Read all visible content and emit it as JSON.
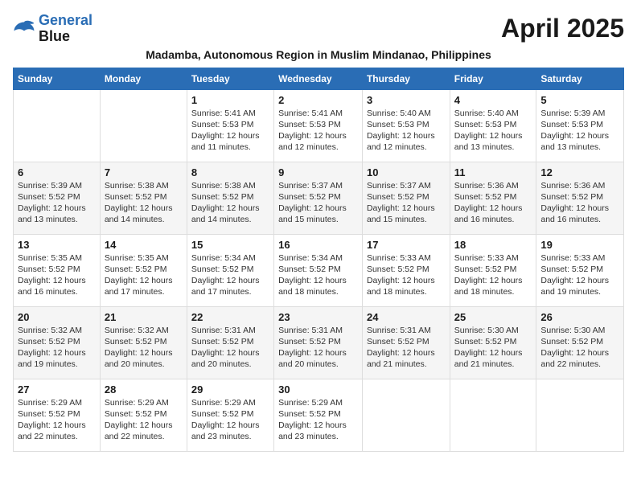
{
  "logo": {
    "line1": "General",
    "line2": "Blue"
  },
  "title": "April 2025",
  "subtitle": "Madamba, Autonomous Region in Muslim Mindanao, Philippines",
  "weekdays": [
    "Sunday",
    "Monday",
    "Tuesday",
    "Wednesday",
    "Thursday",
    "Friday",
    "Saturday"
  ],
  "weeks": [
    [
      {
        "day": "",
        "info": ""
      },
      {
        "day": "",
        "info": ""
      },
      {
        "day": "1",
        "info": "Sunrise: 5:41 AM\nSunset: 5:53 PM\nDaylight: 12 hours and 11 minutes."
      },
      {
        "day": "2",
        "info": "Sunrise: 5:41 AM\nSunset: 5:53 PM\nDaylight: 12 hours and 12 minutes."
      },
      {
        "day": "3",
        "info": "Sunrise: 5:40 AM\nSunset: 5:53 PM\nDaylight: 12 hours and 12 minutes."
      },
      {
        "day": "4",
        "info": "Sunrise: 5:40 AM\nSunset: 5:53 PM\nDaylight: 12 hours and 13 minutes."
      },
      {
        "day": "5",
        "info": "Sunrise: 5:39 AM\nSunset: 5:53 PM\nDaylight: 12 hours and 13 minutes."
      }
    ],
    [
      {
        "day": "6",
        "info": "Sunrise: 5:39 AM\nSunset: 5:52 PM\nDaylight: 12 hours and 13 minutes."
      },
      {
        "day": "7",
        "info": "Sunrise: 5:38 AM\nSunset: 5:52 PM\nDaylight: 12 hours and 14 minutes."
      },
      {
        "day": "8",
        "info": "Sunrise: 5:38 AM\nSunset: 5:52 PM\nDaylight: 12 hours and 14 minutes."
      },
      {
        "day": "9",
        "info": "Sunrise: 5:37 AM\nSunset: 5:52 PM\nDaylight: 12 hours and 15 minutes."
      },
      {
        "day": "10",
        "info": "Sunrise: 5:37 AM\nSunset: 5:52 PM\nDaylight: 12 hours and 15 minutes."
      },
      {
        "day": "11",
        "info": "Sunrise: 5:36 AM\nSunset: 5:52 PM\nDaylight: 12 hours and 16 minutes."
      },
      {
        "day": "12",
        "info": "Sunrise: 5:36 AM\nSunset: 5:52 PM\nDaylight: 12 hours and 16 minutes."
      }
    ],
    [
      {
        "day": "13",
        "info": "Sunrise: 5:35 AM\nSunset: 5:52 PM\nDaylight: 12 hours and 16 minutes."
      },
      {
        "day": "14",
        "info": "Sunrise: 5:35 AM\nSunset: 5:52 PM\nDaylight: 12 hours and 17 minutes."
      },
      {
        "day": "15",
        "info": "Sunrise: 5:34 AM\nSunset: 5:52 PM\nDaylight: 12 hours and 17 minutes."
      },
      {
        "day": "16",
        "info": "Sunrise: 5:34 AM\nSunset: 5:52 PM\nDaylight: 12 hours and 18 minutes."
      },
      {
        "day": "17",
        "info": "Sunrise: 5:33 AM\nSunset: 5:52 PM\nDaylight: 12 hours and 18 minutes."
      },
      {
        "day": "18",
        "info": "Sunrise: 5:33 AM\nSunset: 5:52 PM\nDaylight: 12 hours and 18 minutes."
      },
      {
        "day": "19",
        "info": "Sunrise: 5:33 AM\nSunset: 5:52 PM\nDaylight: 12 hours and 19 minutes."
      }
    ],
    [
      {
        "day": "20",
        "info": "Sunrise: 5:32 AM\nSunset: 5:52 PM\nDaylight: 12 hours and 19 minutes."
      },
      {
        "day": "21",
        "info": "Sunrise: 5:32 AM\nSunset: 5:52 PM\nDaylight: 12 hours and 20 minutes."
      },
      {
        "day": "22",
        "info": "Sunrise: 5:31 AM\nSunset: 5:52 PM\nDaylight: 12 hours and 20 minutes."
      },
      {
        "day": "23",
        "info": "Sunrise: 5:31 AM\nSunset: 5:52 PM\nDaylight: 12 hours and 20 minutes."
      },
      {
        "day": "24",
        "info": "Sunrise: 5:31 AM\nSunset: 5:52 PM\nDaylight: 12 hours and 21 minutes."
      },
      {
        "day": "25",
        "info": "Sunrise: 5:30 AM\nSunset: 5:52 PM\nDaylight: 12 hours and 21 minutes."
      },
      {
        "day": "26",
        "info": "Sunrise: 5:30 AM\nSunset: 5:52 PM\nDaylight: 12 hours and 22 minutes."
      }
    ],
    [
      {
        "day": "27",
        "info": "Sunrise: 5:29 AM\nSunset: 5:52 PM\nDaylight: 12 hours and 22 minutes."
      },
      {
        "day": "28",
        "info": "Sunrise: 5:29 AM\nSunset: 5:52 PM\nDaylight: 12 hours and 22 minutes."
      },
      {
        "day": "29",
        "info": "Sunrise: 5:29 AM\nSunset: 5:52 PM\nDaylight: 12 hours and 23 minutes."
      },
      {
        "day": "30",
        "info": "Sunrise: 5:29 AM\nSunset: 5:52 PM\nDaylight: 12 hours and 23 minutes."
      },
      {
        "day": "",
        "info": ""
      },
      {
        "day": "",
        "info": ""
      },
      {
        "day": "",
        "info": ""
      }
    ]
  ]
}
